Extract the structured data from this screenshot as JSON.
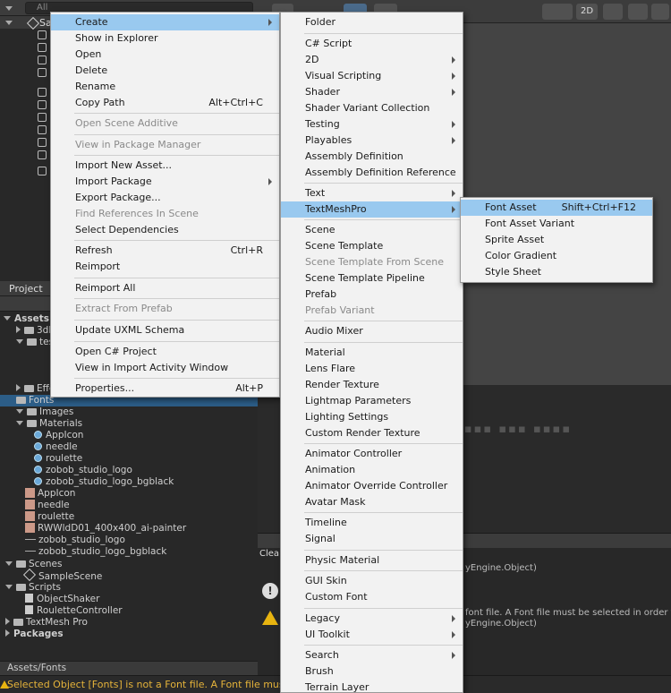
{
  "hierarchy": {
    "search_placeholder": "All",
    "scene_name": "Sa"
  },
  "scene_toolbar": {
    "mode_2d": "2D"
  },
  "project": {
    "tab_label": "Project",
    "tree": [
      {
        "label": "Assets",
        "kind": "root"
      },
      {
        "label": "3dMo",
        "kind": "folder"
      },
      {
        "label": "tes",
        "kind": "folder"
      },
      {
        "label": "Effec",
        "kind": "folder"
      },
      {
        "label": "Fonts",
        "kind": "folder",
        "selected": true
      },
      {
        "label": "Images",
        "kind": "folder"
      },
      {
        "label": "Materials",
        "kind": "folder"
      },
      {
        "label": "AppIcon",
        "kind": "material"
      },
      {
        "label": "needle",
        "kind": "material"
      },
      {
        "label": "roulette",
        "kind": "material"
      },
      {
        "label": "zobob_studio_logo",
        "kind": "material"
      },
      {
        "label": "zobob_studio_logo_bgblack",
        "kind": "material"
      },
      {
        "label": "AppIcon",
        "kind": "image"
      },
      {
        "label": "needle",
        "kind": "image"
      },
      {
        "label": "roulette",
        "kind": "image"
      },
      {
        "label": "RWWldD01_400x400_ai-painter",
        "kind": "image"
      },
      {
        "label": "zobob_studio_logo",
        "kind": "line"
      },
      {
        "label": "zobob_studio_logo_bgblack",
        "kind": "line"
      },
      {
        "label": "Scenes",
        "kind": "folder"
      },
      {
        "label": "SampleScene",
        "kind": "scene"
      },
      {
        "label": "Scripts",
        "kind": "folder"
      },
      {
        "label": "ObjectShaker",
        "kind": "script"
      },
      {
        "label": "RouletteController",
        "kind": "script"
      },
      {
        "label": "TextMesh Pro",
        "kind": "folder"
      },
      {
        "label": "Packages",
        "kind": "root"
      }
    ],
    "path": "Assets/Fonts"
  },
  "console": {
    "clear_label": "Clea",
    "lines": [
      "yEngine.Object)",
      "font file. A Font file must be selected in order to crea",
      "yEngine.Object)"
    ]
  },
  "status_message": "Selected Object [Fonts] is not a Font file. A Font file must be selected",
  "context_menu": {
    "items": [
      {
        "label": "Create",
        "submenu": true,
        "highlighted": true
      },
      {
        "label": "Show in Explorer"
      },
      {
        "label": "Open"
      },
      {
        "label": "Delete"
      },
      {
        "label": "Rename"
      },
      {
        "label": "Copy Path",
        "shortcut": "Alt+Ctrl+C"
      },
      {
        "label": "Open Scene Additive",
        "disabled": true
      },
      {
        "label": "View in Package Manager",
        "disabled": true
      },
      {
        "label": "Import New Asset..."
      },
      {
        "label": "Import Package",
        "submenu": true
      },
      {
        "label": "Export Package..."
      },
      {
        "label": "Find References In Scene",
        "disabled": true
      },
      {
        "label": "Select Dependencies"
      },
      {
        "label": "Refresh",
        "shortcut": "Ctrl+R"
      },
      {
        "label": "Reimport"
      },
      {
        "label": "Reimport All"
      },
      {
        "label": "Extract From Prefab",
        "disabled": true
      },
      {
        "label": "Update UXML Schema"
      },
      {
        "label": "Open C# Project"
      },
      {
        "label": "View in Import Activity Window"
      },
      {
        "label": "Properties...",
        "shortcut": "Alt+P"
      }
    ]
  },
  "create_menu": {
    "items": [
      {
        "label": "Folder"
      },
      {
        "label": "C# Script"
      },
      {
        "label": "2D",
        "submenu": true
      },
      {
        "label": "Visual Scripting",
        "submenu": true
      },
      {
        "label": "Shader",
        "submenu": true
      },
      {
        "label": "Shader Variant Collection"
      },
      {
        "label": "Testing",
        "submenu": true
      },
      {
        "label": "Playables",
        "submenu": true
      },
      {
        "label": "Assembly Definition"
      },
      {
        "label": "Assembly Definition Reference"
      },
      {
        "label": "Text",
        "submenu": true
      },
      {
        "label": "TextMeshPro",
        "submenu": true,
        "highlighted": true
      },
      {
        "label": "Scene"
      },
      {
        "label": "Scene Template"
      },
      {
        "label": "Scene Template From Scene",
        "disabled": true
      },
      {
        "label": "Scene Template Pipeline"
      },
      {
        "label": "Prefab"
      },
      {
        "label": "Prefab Variant",
        "disabled": true
      },
      {
        "label": "Audio Mixer"
      },
      {
        "label": "Material"
      },
      {
        "label": "Lens Flare"
      },
      {
        "label": "Render Texture"
      },
      {
        "label": "Lightmap Parameters"
      },
      {
        "label": "Lighting Settings"
      },
      {
        "label": "Custom Render Texture"
      },
      {
        "label": "Animator Controller"
      },
      {
        "label": "Animation"
      },
      {
        "label": "Animator Override Controller"
      },
      {
        "label": "Avatar Mask"
      },
      {
        "label": "Timeline"
      },
      {
        "label": "Signal"
      },
      {
        "label": "Physic Material"
      },
      {
        "label": "GUI Skin"
      },
      {
        "label": "Custom Font"
      },
      {
        "label": "Legacy",
        "submenu": true
      },
      {
        "label": "UI Toolkit",
        "submenu": true
      },
      {
        "label": "Search",
        "submenu": true
      },
      {
        "label": "Brush"
      },
      {
        "label": "Terrain Layer"
      }
    ]
  },
  "textmeshpro_menu": {
    "items": [
      {
        "label": "Font Asset",
        "shortcut": "Shift+Ctrl+F12",
        "highlighted": true
      },
      {
        "label": "Font Asset Variant"
      },
      {
        "label": "Sprite Asset"
      },
      {
        "label": "Color Gradient"
      },
      {
        "label": "Style Sheet"
      }
    ]
  }
}
